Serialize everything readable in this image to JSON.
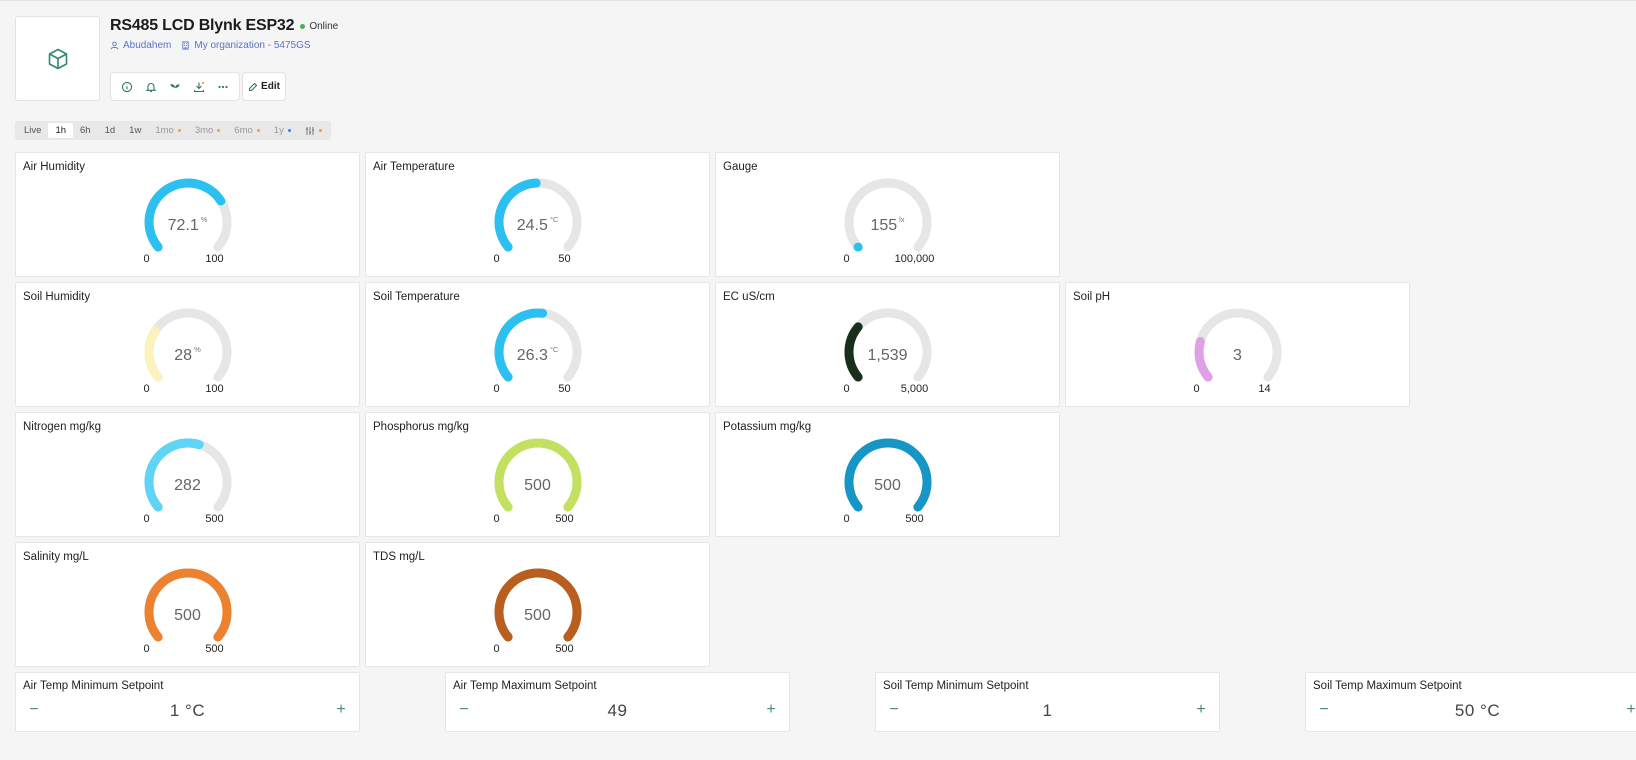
{
  "device": {
    "title": "RS485 LCD Blynk ESP32",
    "status": "Online",
    "owner": "Abudahem",
    "organization": "My organization - 5475GS",
    "edit_label": "Edit"
  },
  "toolbar_icons": [
    "info-icon",
    "bell-icon",
    "plant-icon",
    "download-icon",
    "more-icon"
  ],
  "tabs": [
    {
      "label": "Live",
      "active": false,
      "disabled": false,
      "dot": ""
    },
    {
      "label": "1h",
      "active": true,
      "disabled": false,
      "dot": ""
    },
    {
      "label": "6h",
      "active": false,
      "disabled": false,
      "dot": ""
    },
    {
      "label": "1d",
      "active": false,
      "disabled": false,
      "dot": ""
    },
    {
      "label": "1w",
      "active": false,
      "disabled": false,
      "dot": ""
    },
    {
      "label": "1mo",
      "active": false,
      "disabled": true,
      "dot": "#f29e38"
    },
    {
      "label": "3mo",
      "active": false,
      "disabled": true,
      "dot": "#f29e38"
    },
    {
      "label": "6mo",
      "active": false,
      "disabled": true,
      "dot": "#f29e38"
    },
    {
      "label": "1y",
      "active": false,
      "disabled": true,
      "dot": "#3b82f6"
    },
    {
      "label": "",
      "active": false,
      "disabled": true,
      "dot": "#f29e38",
      "icon": "sliders-icon"
    }
  ],
  "gauges": [
    {
      "title": "Air Humidity",
      "value": "72.1",
      "unit": "%",
      "min": "0",
      "max": "100",
      "fraction": 0.721,
      "color": "#2bc0f0"
    },
    {
      "title": "Air Temperature",
      "value": "24.5",
      "unit": "°C",
      "min": "0",
      "max": "50",
      "fraction": 0.49,
      "color": "#2bc0f0"
    },
    {
      "title": "Gauge",
      "value": "155",
      "unit": "lx",
      "min": "0",
      "max": "100,000",
      "fraction": 0.0,
      "color": "#2bc0f0"
    },
    {
      "title": "Soil Humidity",
      "value": "28",
      "unit": "%",
      "min": "0",
      "max": "100",
      "fraction": 0.28,
      "color": "#fbf2bd"
    },
    {
      "title": "Soil Temperature",
      "value": "26.3",
      "unit": "°C",
      "min": "0",
      "max": "50",
      "fraction": 0.526,
      "color": "#2bc0f0"
    },
    {
      "title": "EC uS/cm",
      "value": "1,539",
      "unit": "",
      "min": "0",
      "max": "5,000",
      "fraction": 0.308,
      "color": "#1a2e1c"
    },
    {
      "title": "Soil pH",
      "value": "3",
      "unit": "",
      "min": "0",
      "max": "14",
      "fraction": 0.214,
      "color": "#dfa0e6"
    },
    {
      "title": "Nitrogen mg/kg",
      "value": "282",
      "unit": "",
      "min": "0",
      "max": "500",
      "fraction": 0.564,
      "color": "#5fd4f5"
    },
    {
      "title": "Phosphorus mg/kg",
      "value": "500",
      "unit": "",
      "min": "0",
      "max": "500",
      "fraction": 1.0,
      "color": "#c4e060"
    },
    {
      "title": "Potassium mg/kg",
      "value": "500",
      "unit": "",
      "min": "0",
      "max": "500",
      "fraction": 1.0,
      "color": "#1696c4"
    },
    {
      "title": "Salinity mg/L",
      "value": "500",
      "unit": "",
      "min": "0",
      "max": "500",
      "fraction": 1.0,
      "color": "#ec8230"
    },
    {
      "title": "TDS mg/L",
      "value": "500",
      "unit": "",
      "min": "0",
      "max": "500",
      "fraction": 1.0,
      "color": "#b85f20"
    }
  ],
  "setpoints": [
    {
      "title": "Air Temp Minimum Setpoint",
      "value": "1 °C"
    },
    {
      "title": "Air Temp Maximum Setpoint",
      "value": "49"
    },
    {
      "title": "Soil Temp Minimum Setpoint",
      "value": "1"
    },
    {
      "title": "Soil Temp Maximum Setpoint",
      "value": "50 °C"
    }
  ],
  "setpoint_controls": {
    "minus": "−",
    "plus": "+"
  }
}
